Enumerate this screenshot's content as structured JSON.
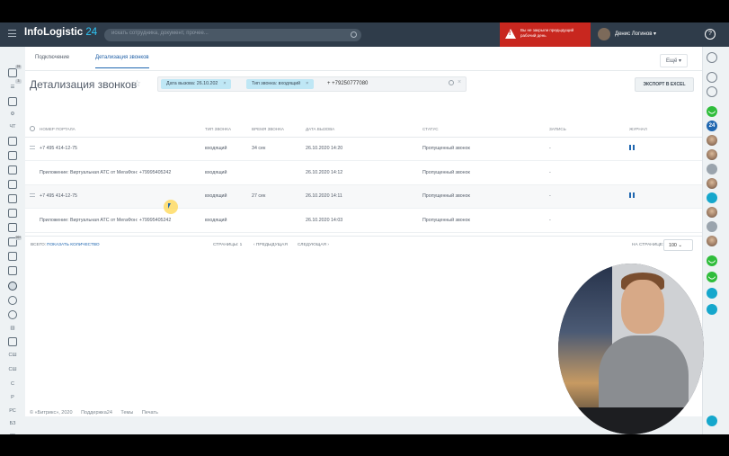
{
  "topbar": {
    "logo_main": "InfoLogistic",
    "logo_24": "24",
    "search_placeholder": "искать сотрудника, документ, прочее...",
    "alert_text": "Вы не закрыли предыдущий рабочий день",
    "user_name": "Денис Логинов ▾",
    "help": "?"
  },
  "tabs": {
    "connection": "Подключение",
    "details": "Детализация звонков",
    "more": "Ещё ▾"
  },
  "page": {
    "title": "Детализация звонков",
    "export": "ЭКСПОРТ В EXCEL"
  },
  "filter": {
    "chip1": "Дата вызова: 26.10.202",
    "chip2": "Тип звонка: входящий",
    "text": "+ +79250777080"
  },
  "table": {
    "headers": [
      "НОМЕР ПОРТАЛА",
      "ТИП ЗВОНКА",
      "ВРЕМЯ ЗВОНКА",
      "ДАТА ВЫЗОВА",
      "СТАТУС",
      "ЗАПИСЬ",
      "ЖУРНАЛ"
    ],
    "rows": [
      [
        "+7 495 414-12-75",
        "входящий",
        "34 сек",
        "26.10.2020 14:20",
        "Пропущенный звонок",
        "-",
        ""
      ],
      [
        "Приложение: Виртуальная АТС от МегаФон: +79995405242",
        "входящий",
        "",
        "26.10.2020 14:12",
        "Пропущенный звонок",
        "-",
        ""
      ],
      [
        "+7 495 414-12-75",
        "входящий",
        "27 сек",
        "26.10.2020 14:11",
        "Пропущенный звонок",
        "-",
        ""
      ],
      [
        "Приложение: Виртуальная АТС от МегаФон: +79995405242",
        "входящий",
        "",
        "26.10.2020 14:03",
        "Пропущенный звонок",
        "-",
        ""
      ]
    ]
  },
  "pager": {
    "total_label": "ВСЕГО:",
    "show_count": "ПОКАЗАТЬ КОЛИЧЕСТВО",
    "pages_label": "СТРАНИЦЫ: 1",
    "prev": "‹ ПРЕДЫДУЩАЯ",
    "next": "СЛЕДУЮЩАЯ ›",
    "per_page_label": "НА СТРАНИЦЕ:",
    "per_page_value": "100"
  },
  "footer": {
    "copy": "© «Битрикс», 2020",
    "support": "Поддержка24",
    "themes": "Темы",
    "print": "Печать"
  },
  "leftbar_labels": [
    "ЧТ",
    "СШ",
    "СШ",
    "С",
    "Р",
    "РС",
    "БЗ",
    "ЗГ",
    "НТ"
  ],
  "colors": {
    "topbar": "#2f3c4a",
    "accent": "#2067b0",
    "alert": "#c8271f",
    "chip": "#bfe7f5",
    "green": "#2fbd3b"
  }
}
